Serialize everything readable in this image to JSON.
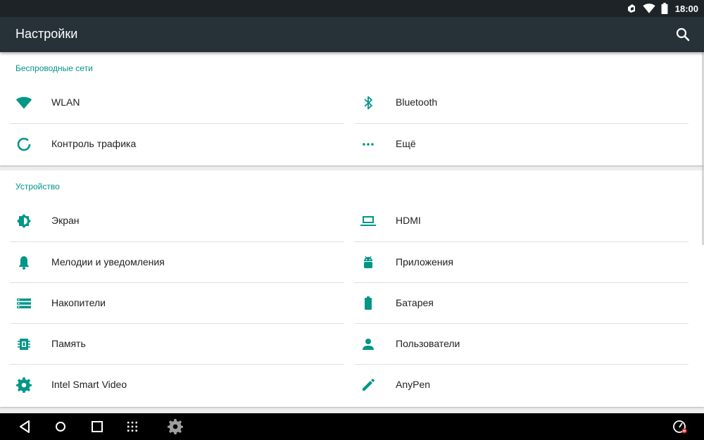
{
  "status_bar": {
    "time": "18:00",
    "icons": [
      "notification-icon",
      "wifi-signal-icon",
      "battery-icon"
    ]
  },
  "app_bar": {
    "title": "Настройки",
    "search_icon": "search-icon"
  },
  "sections": [
    {
      "title": "Беспроводные сети",
      "items": [
        {
          "label": "WLAN",
          "icon": "wifi-icon"
        },
        {
          "label": "Bluetooth",
          "icon": "bluetooth-icon"
        },
        {
          "label": "Контроль трафика",
          "icon": "data-usage-icon"
        },
        {
          "label": "Ещё",
          "icon": "more-horiz-icon"
        }
      ]
    },
    {
      "title": "Устройство",
      "items": [
        {
          "label": "Экран",
          "icon": "brightness-icon"
        },
        {
          "label": "HDMI",
          "icon": "laptop-icon"
        },
        {
          "label": "Мелодии и уведомления",
          "icon": "bell-icon"
        },
        {
          "label": "Приложения",
          "icon": "android-icon"
        },
        {
          "label": "Накопители",
          "icon": "storage-icon"
        },
        {
          "label": "Батарея",
          "icon": "battery-icon"
        },
        {
          "label": "Память",
          "icon": "memory-icon"
        },
        {
          "label": "Пользователи",
          "icon": "person-icon"
        },
        {
          "label": "Intel Smart Video",
          "icon": "gear-icon"
        },
        {
          "label": "AnyPen",
          "icon": "pen-icon"
        }
      ]
    }
  ],
  "nav_bar": {
    "buttons": [
      "back-icon",
      "home-icon",
      "recents-icon",
      "apps-grid-icon",
      "settings-app-icon",
      "speedometer-icon"
    ]
  },
  "colors": {
    "accent": "#009688",
    "app_bar": "#263238",
    "status_bar": "#1d2327",
    "nav_bar": "#000000",
    "text_primary": "#212121"
  }
}
